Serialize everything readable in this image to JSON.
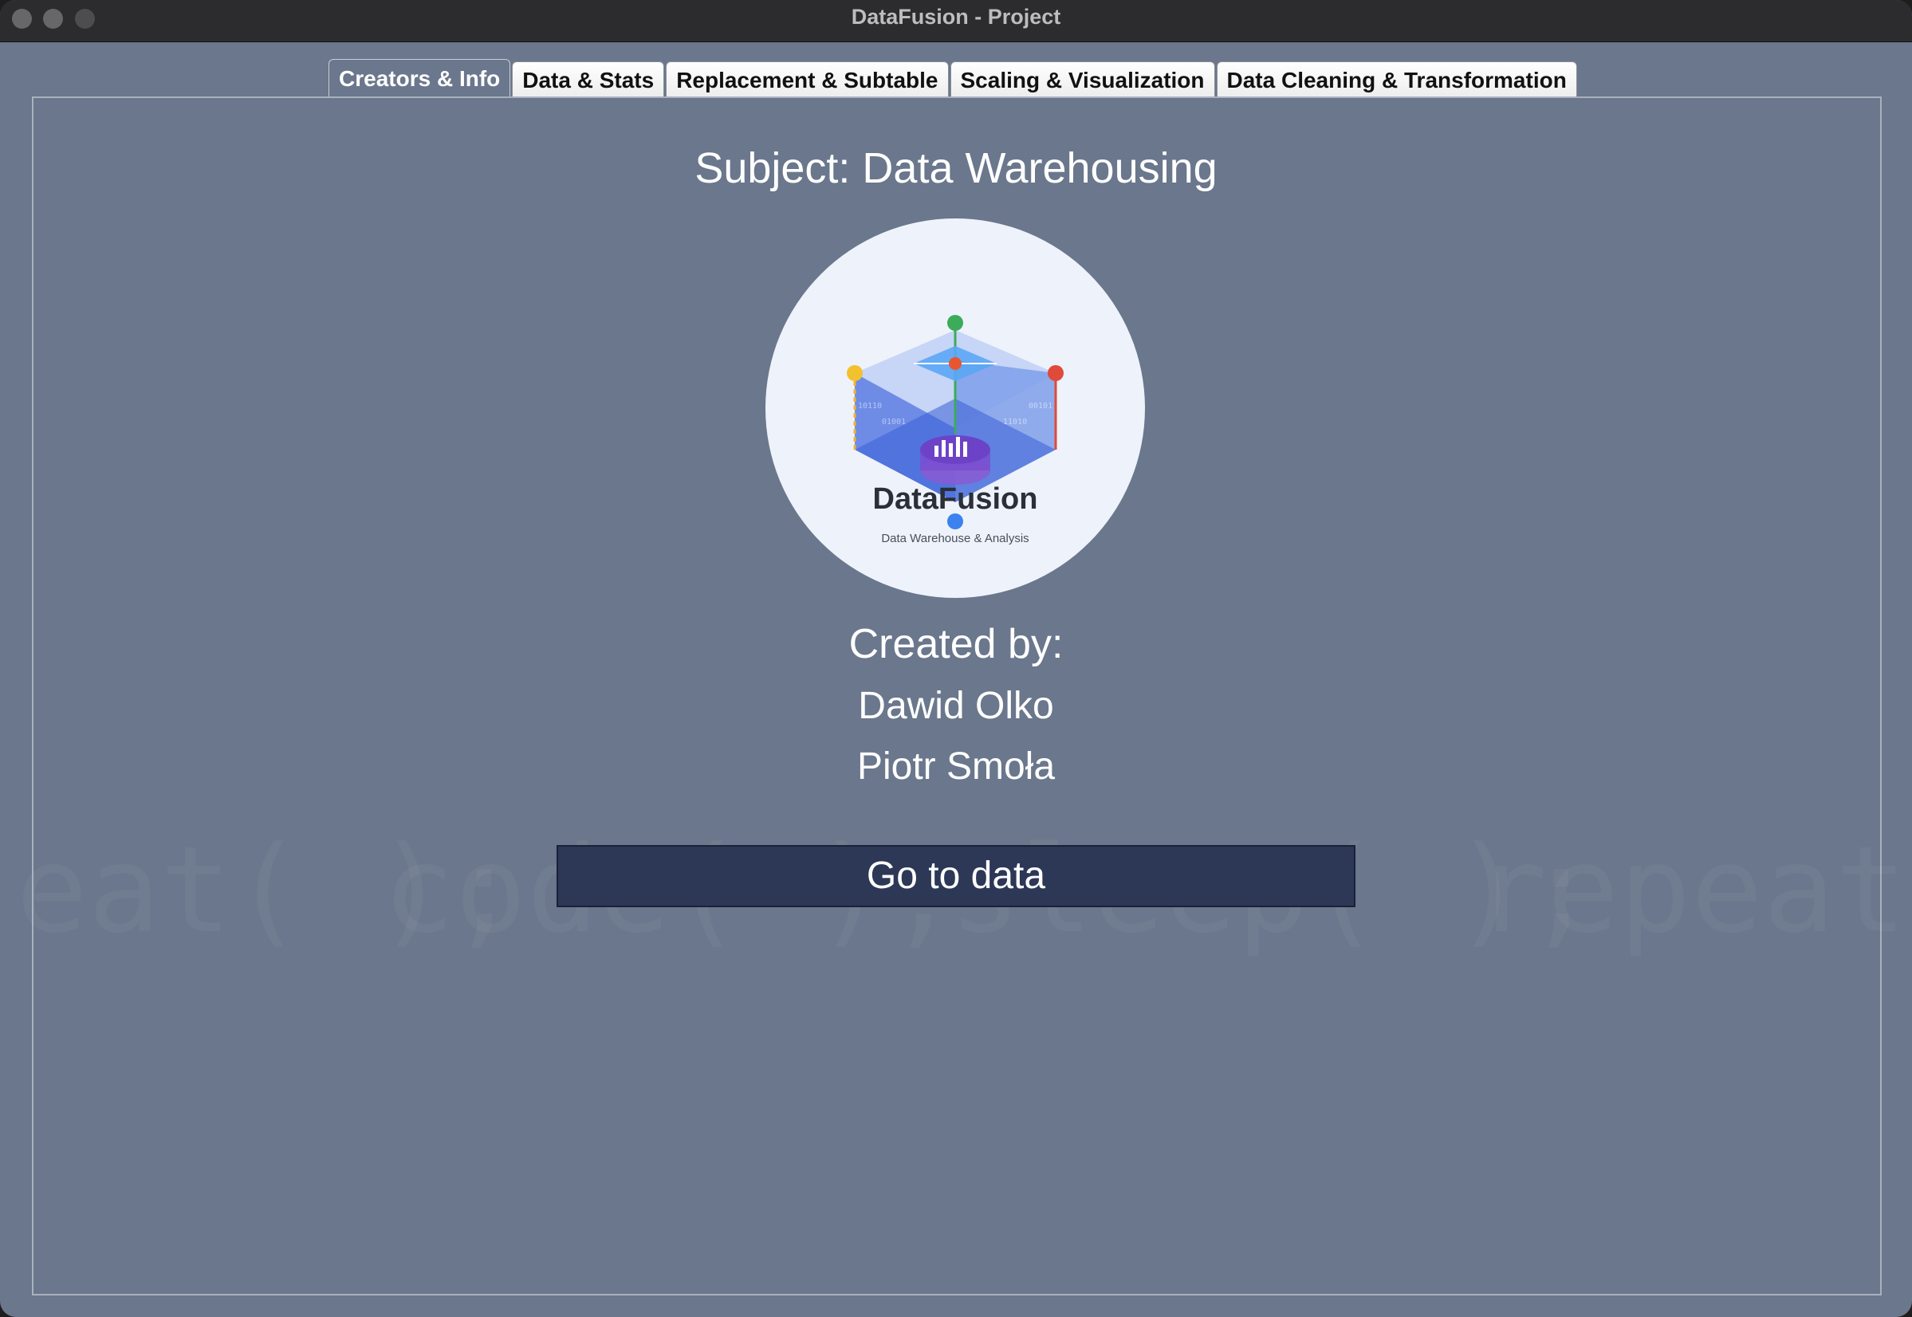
{
  "window": {
    "title": "DataFusion - Project"
  },
  "tabs": [
    {
      "label": "Creators & Info",
      "active": true
    },
    {
      "label": "Data & Stats",
      "active": false
    },
    {
      "label": "Replacement & Subtable",
      "active": false
    },
    {
      "label": "Scaling & Visualization",
      "active": false
    },
    {
      "label": "Data Cleaning & Transformation",
      "active": false
    }
  ],
  "main": {
    "subject": "Subject: Data Warehousing",
    "logo": {
      "name": "DataFusion",
      "tagline": "Data Warehouse & Analysis",
      "bits": [
        "10110",
        "01001",
        "00101",
        "11010"
      ]
    },
    "created_by_label": "Created by:",
    "creators": [
      "Dawid Olko",
      "Piotr Smoła"
    ],
    "go_button_label": "Go to data"
  },
  "background": {
    "watermark_words": [
      "eat( );",
      "code( );",
      "sleep( );",
      "repeat( );"
    ]
  },
  "colors": {
    "window_bg": "#6a778c",
    "titlebar_bg": "#2c2c2e",
    "button_bg": "#2d3857",
    "logo_bg": "#eef2fb"
  }
}
